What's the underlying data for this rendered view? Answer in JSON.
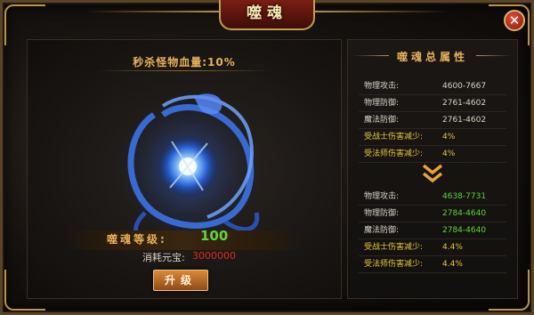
{
  "window": {
    "title": "噬魂"
  },
  "close": {
    "label": "✕"
  },
  "left": {
    "kill_label": "秒杀怪物血量:",
    "kill_value": "10%",
    "level_label": "噬魂等级:",
    "level_value": "100",
    "cost_label": "消耗元宝:",
    "cost_value": "3000000",
    "upgrade_label": "升级"
  },
  "right": {
    "title": "噬魂总属性",
    "current": [
      {
        "label": "物理攻击:",
        "value": "4600-7667"
      },
      {
        "label": "物理防御:",
        "value": "2761-4602"
      },
      {
        "label": "魔法防御:",
        "value": "2761-4602"
      },
      {
        "label": "受战士伤害减少:",
        "value": "4%"
      },
      {
        "label": "受法师伤害减少:",
        "value": "4%"
      }
    ],
    "next": [
      {
        "label": "物理攻击:",
        "value": "4638-7731"
      },
      {
        "label": "物理防御:",
        "value": "2784-4640"
      },
      {
        "label": "魔法防御:",
        "value": "2784-4640"
      },
      {
        "label": "受战士伤害减少:",
        "value": "4.4%"
      },
      {
        "label": "受法师伤害减少:",
        "value": "4.4%"
      }
    ]
  },
  "colors": {
    "gold": "#e7b15a",
    "green": "#5fd43a",
    "red": "#e22b1c",
    "yellow": "#e6c63a"
  }
}
